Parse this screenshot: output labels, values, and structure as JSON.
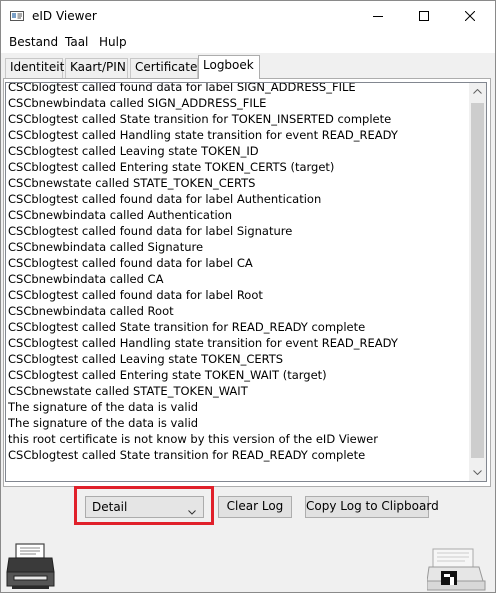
{
  "window": {
    "title": "eID Viewer",
    "minimize_icon": "minimize-icon",
    "maximize_icon": "maximize-icon",
    "close_icon": "close-icon"
  },
  "menu": {
    "items": [
      "Bestand",
      "Taal",
      "Hulp"
    ]
  },
  "tabs": {
    "items": [
      {
        "label": "Identiteit",
        "active": false
      },
      {
        "label": "Kaart/PIN",
        "active": false
      },
      {
        "label": "Certificaten",
        "active": false
      },
      {
        "label": "Logboek",
        "active": true
      }
    ]
  },
  "log": {
    "lines": [
      "CSCblogtest called found data for label SIGN_ADDRESS_FILE",
      "CSCbnewbindata called SIGN_ADDRESS_FILE",
      "CSCblogtest called State transition for TOKEN_INSERTED complete",
      "CSCblogtest called Handling state transition for event READ_READY",
      "CSCblogtest called Leaving state TOKEN_ID",
      "CSCblogtest called Entering state TOKEN_CERTS (target)",
      "CSCbnewstate called STATE_TOKEN_CERTS",
      "CSCblogtest called found data for label Authentication",
      "CSCbnewbindata called Authentication",
      "CSCblogtest called found data for label Signature",
      "CSCbnewbindata called Signature",
      "CSCblogtest called found data for label CA",
      "CSCbnewbindata called CA",
      "CSCblogtest called found data for label Root",
      "CSCbnewbindata called Root",
      "CSCblogtest called State transition for READ_READY complete",
      "CSCblogtest called Handling state transition for event READ_READY",
      "CSCblogtest called Leaving state TOKEN_CERTS",
      "CSCblogtest called Entering state TOKEN_WAIT (target)",
      "CSCbnewstate called STATE_TOKEN_WAIT",
      "The signature of the data is valid",
      "The signature of the data is valid",
      "this root certificate is not know by this version of the eID Viewer",
      "CSCblogtest called State transition for READ_READY complete"
    ]
  },
  "controls": {
    "level_selected": "Detail",
    "clear_label": "Clear Log",
    "copy_label": "Copy Log to Clipboard"
  },
  "colors": {
    "highlight": "#e0202a"
  },
  "icons": {
    "app": "eid-viewer-app-icon",
    "print": "printer-icon",
    "card_reader": "card-reader-icon"
  }
}
